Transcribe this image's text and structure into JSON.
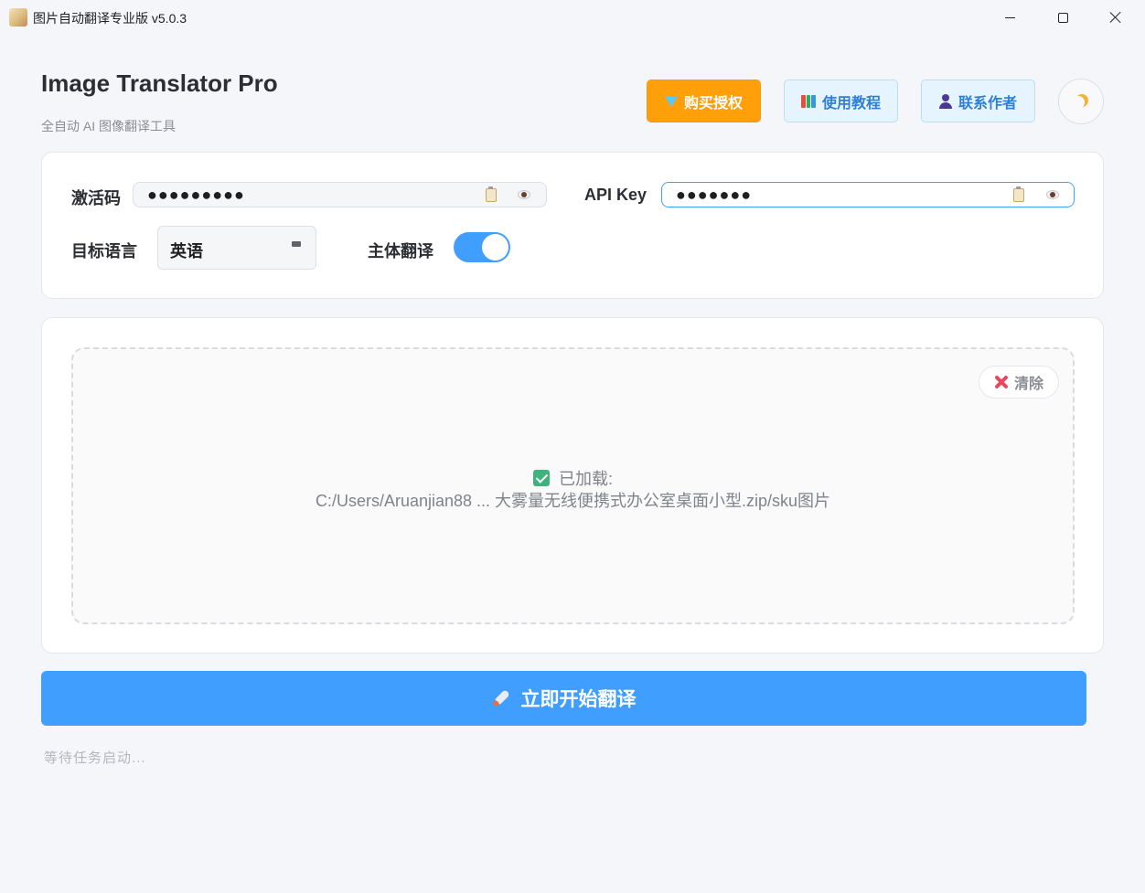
{
  "window": {
    "title": "图片自动翻译专业版 v5.0.3",
    "icon": "app-image-icon",
    "controls": [
      "minimize",
      "maximize",
      "close"
    ]
  },
  "header": {
    "title": "Image Translator Pro",
    "subtitle": "全自动 AI 图像翻译工具",
    "buttons": {
      "buy": {
        "label": "购买授权",
        "icon": "gem-icon",
        "color": "#ff9f0a"
      },
      "tutorial": {
        "label": "使用教程",
        "icon": "books-icon"
      },
      "contact": {
        "label": "联系作者",
        "icon": "user-icon"
      }
    },
    "theme_toggle_icon": "moon-icon"
  },
  "settings": {
    "activation_code": {
      "label": "激活码",
      "value": "●●●●●●●●●"
    },
    "api_key": {
      "label": "API Key",
      "value": "●●●●●●●"
    },
    "target_language": {
      "label": "目标语言",
      "value": "英语"
    },
    "subject_translation": {
      "label": "主体翻译",
      "enabled": true
    }
  },
  "dropzone": {
    "clear_label": "清除",
    "loaded_label": "已加载:",
    "path": "C:/Users/Aruanjian88 ... 大雾量无线便携式办公室桌面小型.zip/sku图片"
  },
  "actions": {
    "start_label": "立即开始翻译",
    "accent_color": "#409eff"
  },
  "status": "等待任务启动..."
}
